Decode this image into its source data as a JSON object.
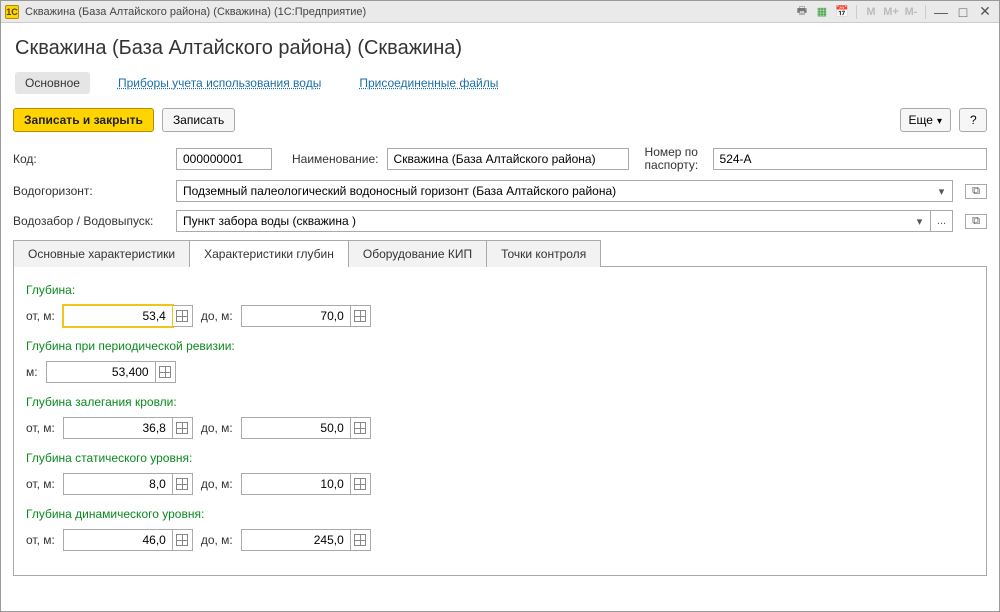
{
  "titlebar": {
    "logo_text": "1C",
    "title": "Скважина (База Алтайского района) (Скважина)  (1С:Предприятие)"
  },
  "page_title": "Скважина (База Алтайского района) (Скважина)",
  "nav": {
    "main": "Основное",
    "meters": "Приборы учета использования воды",
    "files": "Присоединенные файлы"
  },
  "toolbar": {
    "write_close": "Записать и закрыть",
    "write": "Записать",
    "more": "Еще",
    "help": "?"
  },
  "fields": {
    "code_label": "Код:",
    "code_value": "000000001",
    "name_label": "Наименование:",
    "name_value": "Скважина (База Алтайского района)",
    "passport_label": "Номер по паспорту:",
    "passport_value": "524-А",
    "horizon_label": "Водогоризонт:",
    "horizon_value": "Подземный палеологический водоносный горизонт (База Алтайского района)",
    "intake_label": "Водозабор / Водовыпуск:",
    "intake_value": "Пункт забора воды (скважина )"
  },
  "tabs": {
    "t1": "Основные характеристики",
    "t2": "Характеристики глубин",
    "t3": "Оборудование КИП",
    "t4": "Точки контроля"
  },
  "depth": {
    "g1_label": "Глубина:",
    "from": "от, м:",
    "to": "до, м:",
    "g1_from": "53,4",
    "g1_to": "70,0",
    "g2_label": "Глубина при периодической ревизии:",
    "m": "м:",
    "g2_val": "53,400",
    "g3_label": "Глубина залегания кровли:",
    "g3_from": "36,8",
    "g3_to": "50,0",
    "g4_label": "Глубина статического уровня:",
    "g4_from": "8,0",
    "g4_to": "10,0",
    "g5_label": "Глубина динамического уровня:",
    "g5_from": "46,0",
    "g5_to": "245,0"
  }
}
